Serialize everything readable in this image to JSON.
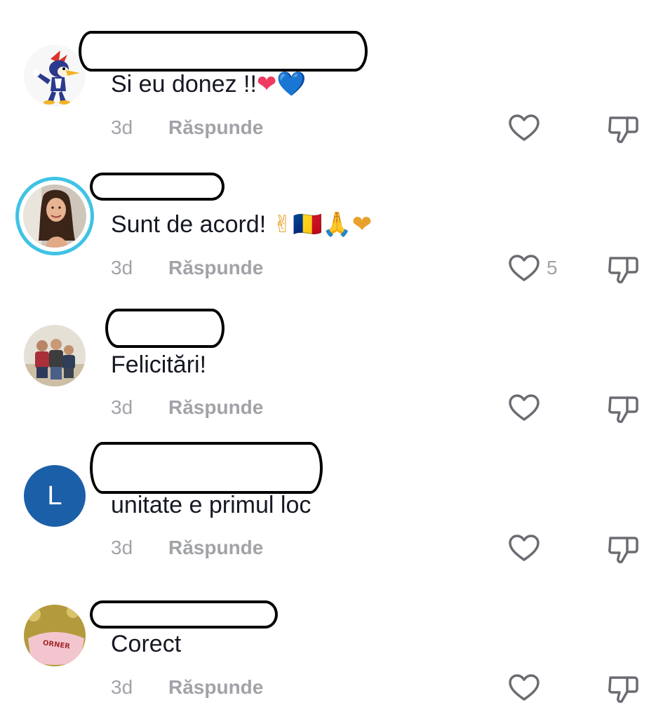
{
  "comments": [
    {
      "avatar": "woodpecker-cartoon-avatar",
      "text": "Si eu donez !!",
      "emojis": "❤💙",
      "time": "3d",
      "reply_label": "Răspunde",
      "likes": ""
    },
    {
      "avatar": "woman-photo-avatar",
      "text": "Sunt de acord! ",
      "emojis": "✌🇷🇴🙏❤",
      "time": "3d",
      "reply_label": "Răspunde",
      "likes": "5"
    },
    {
      "avatar": "family-photo-avatar",
      "text": "Felicitări!",
      "emojis": "",
      "time": "3d",
      "reply_label": "Răspunde",
      "likes": ""
    },
    {
      "avatar": "L",
      "text": "unitate e primul loc",
      "emojis": "",
      "time": "3d",
      "reply_label": "Răspunde",
      "likes": ""
    },
    {
      "avatar": "cup-photo-avatar",
      "text": "Corect",
      "emojis": "",
      "time": "3d",
      "reply_label": "Răspunde",
      "likes": ""
    }
  ],
  "colors": {
    "text": "#161823",
    "meta": "#a2a3a8",
    "story_ring": "#3fc3e5",
    "letter_avatar": "#1b5fa8"
  },
  "icons": [
    "heart-outline-icon",
    "thumbs-down-outline-icon"
  ]
}
